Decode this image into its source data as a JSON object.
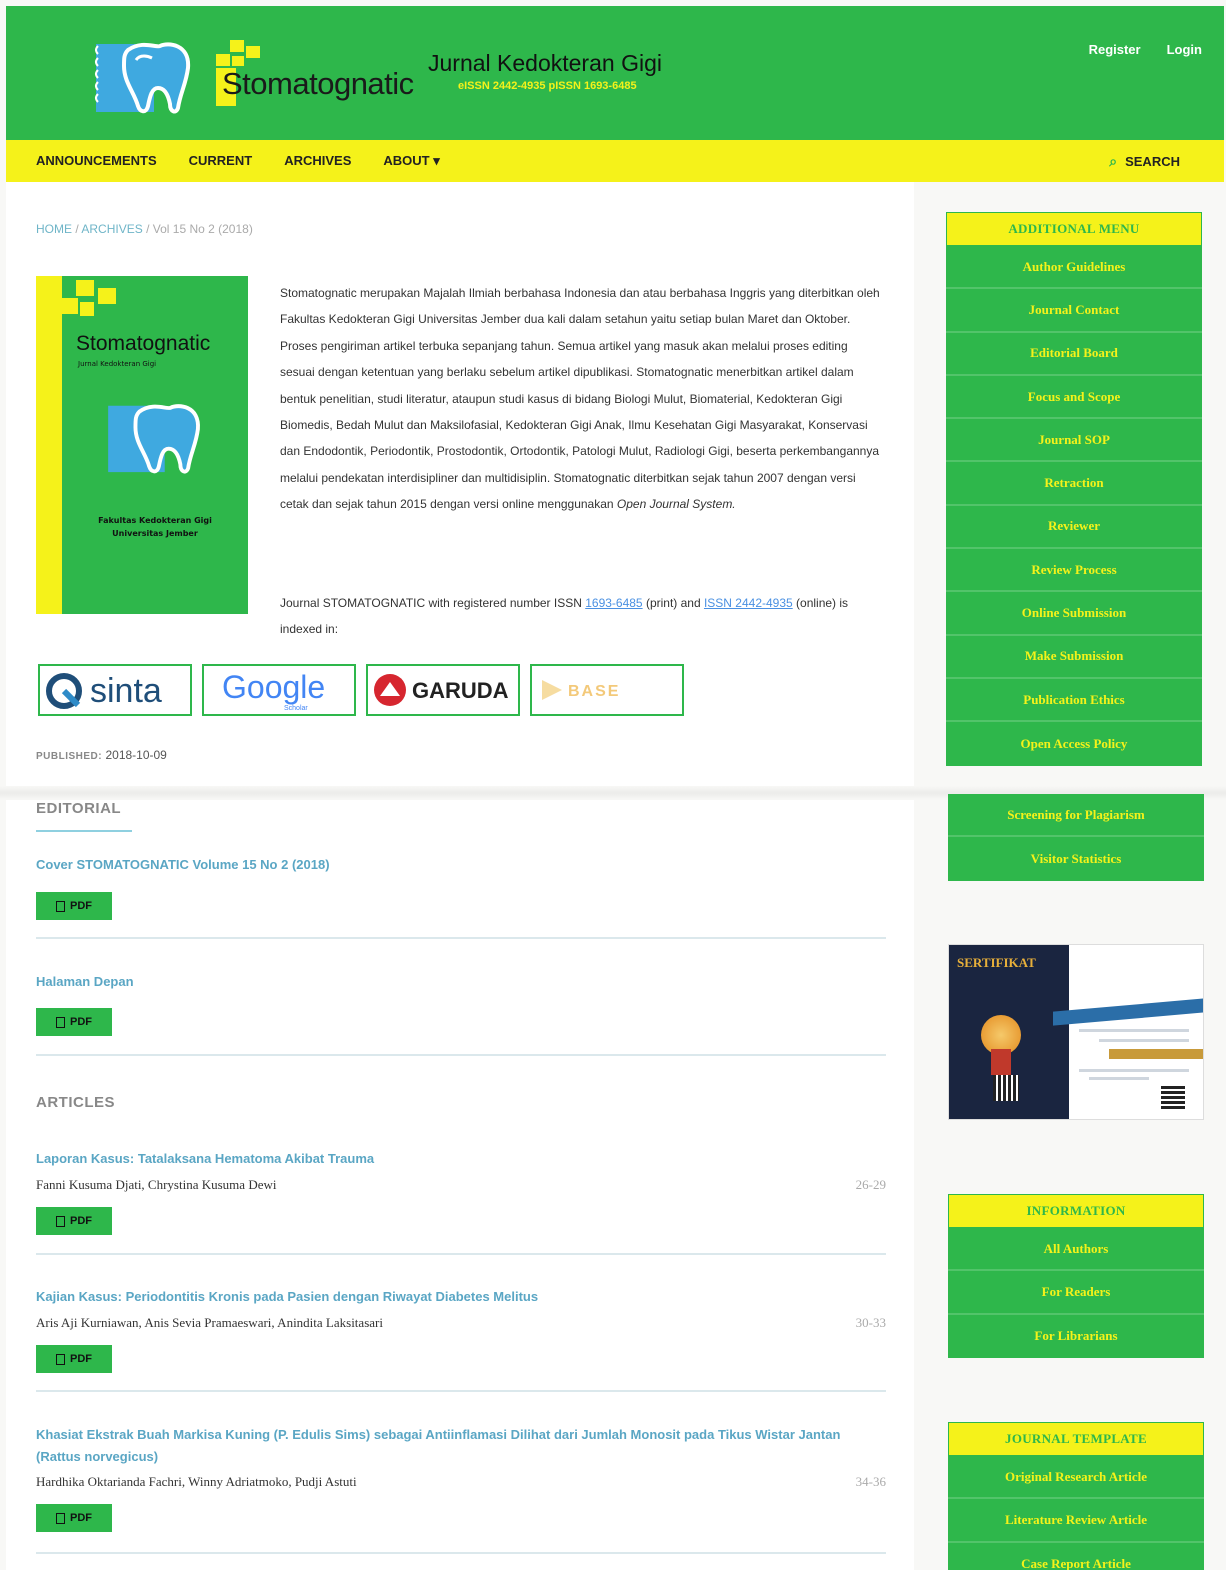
{
  "header": {
    "logo_word": "Stomatognatic",
    "journal_title": "Jurnal Kedokteran Gigi",
    "issn": "eISSN 2442-4935    pISSN 1693-6485",
    "user_nav": [
      "Register",
      "Login"
    ]
  },
  "nav": {
    "items": [
      "ANNOUNCEMENTS",
      "CURRENT",
      "ARCHIVES",
      "ABOUT ▾"
    ],
    "search_label": "SEARCH",
    "search_icon": "search-icon"
  },
  "breadcrumb": {
    "home": "HOME",
    "archives": "ARCHIVES",
    "sep": "/",
    "current": "Vol 15 No 2 (2018)"
  },
  "cover": {
    "logo_word": "Stomatognatic",
    "logo_sub": "Jurnal Kedokteran Gigi",
    "faculty_line1": "Fakultas Kedokteran Gigi",
    "faculty_line2": "Universitas Jember"
  },
  "about": {
    "description_before": "Stomatognatic merupakan Majalah Ilmiah berbahasa Indonesia dan atau berbahasa Inggris yang diterbitkan oleh Fakultas Kedokteran Gigi Universitas Jember dua kali dalam setahun yaitu setiap bulan Maret dan Oktober. Proses pengiriman artikel terbuka sepanjang tahun. Semua artikel yang masuk akan melalui proses editing sesuai dengan ketentuan yang berlaku sebelum artikel dipublikasi. Stomatognatic menerbitkan artikel dalam bentuk penelitian, studi literatur, ataupun studi kasus di bidang Biologi Mulut, Biomaterial, Kedokteran Gigi Biomedis, Bedah Mulut dan Maksilofasial, Kedokteran Gigi Anak, Ilmu Kesehatan Gigi Masyarakat, Konservasi dan Endodontik, Periodontik, Prostodontik, Ortodontik, Patologi Mulut, Radiologi Gigi, beserta perkembangannya melalui pendekatan interdisipliner dan multidisiplin. Stomatognatic diterbitkan sejak tahun 2007 dengan versi cetak dan sejak tahun 2015 dengan versi online menggunakan ",
    "description_italic": "Open Journal System.",
    "indexed_before": "Journal STOMATOGNATIC with registered number ISSN ",
    "issn_print": "1693-6485",
    "indexed_mid": " (print) and ",
    "issn_online": "ISSN 2442-4935",
    "indexed_after": " (online) is indexed in:"
  },
  "indexing": {
    "sinta": "sinta",
    "google": "Google",
    "google_sub": "Scholar",
    "garuda": "GARUDA",
    "base": "BASE"
  },
  "published": {
    "label": "PUBLISHED:",
    "date": "2018-10-09"
  },
  "sections": {
    "editorial": "EDITORIAL",
    "articles": "ARTICLES"
  },
  "editorial_items": [
    {
      "title": "Cover STOMATOGNATIC Volume 15 No 2 (2018)",
      "button": "PDF"
    },
    {
      "title": "Halaman Depan",
      "button": "PDF"
    }
  ],
  "articles": [
    {
      "title": "Laporan Kasus: Tatalaksana Hematoma Akibat Trauma",
      "authors": "Fanni Kusuma Djati, Chrystina Kusuma Dewi",
      "pages": "26-29",
      "button": "PDF"
    },
    {
      "title": "Kajian Kasus: Periodontitis Kronis pada Pasien dengan Riwayat Diabetes Melitus",
      "authors": "Aris Aji Kurniawan, Anis Sevia Pramaeswari, Anindita Laksitasari",
      "pages": "30-33",
      "button": "PDF"
    },
    {
      "title": "Khasiat Ekstrak Buah Markisa Kuning (P. Edulis Sims) sebagai Antiinflamasi Dilihat dari Jumlah Monosit pada Tikus Wistar Jantan (Rattus norvegicus)",
      "authors": "Hardhika Oktarianda Fachri, Winny Adriatmoko, Pudji Astuti",
      "pages": "34-36",
      "button": "PDF"
    }
  ],
  "sidebar": {
    "additional_menu": {
      "title": "ADDITIONAL MENU",
      "items": [
        "Author Guidelines",
        "Journal Contact",
        "Editorial Board",
        "Focus and Scope",
        "Journal SOP",
        "Retraction",
        "Reviewer",
        "Review Process",
        "Online Submission",
        "Make Submission",
        "Publication Ethics",
        "Open Access Policy"
      ]
    },
    "additional_menu_cont": {
      "items": [
        "Screening for Plagiarism",
        "Visitor Statistics"
      ]
    },
    "certificate": {
      "title": "SERTIFIKAT"
    },
    "information": {
      "title": "INFORMATION",
      "items": [
        "All Authors",
        "For Readers",
        "For Librarians"
      ]
    },
    "journal_template": {
      "title": "JOURNAL TEMPLATE",
      "items": [
        "Original Research Article",
        "Literature Review Article",
        "Case Report Article"
      ]
    }
  },
  "colors": {
    "primary_green": "#2eb74b",
    "accent_yellow": "#f5f21a",
    "link_blue": "#5aa6c4"
  }
}
